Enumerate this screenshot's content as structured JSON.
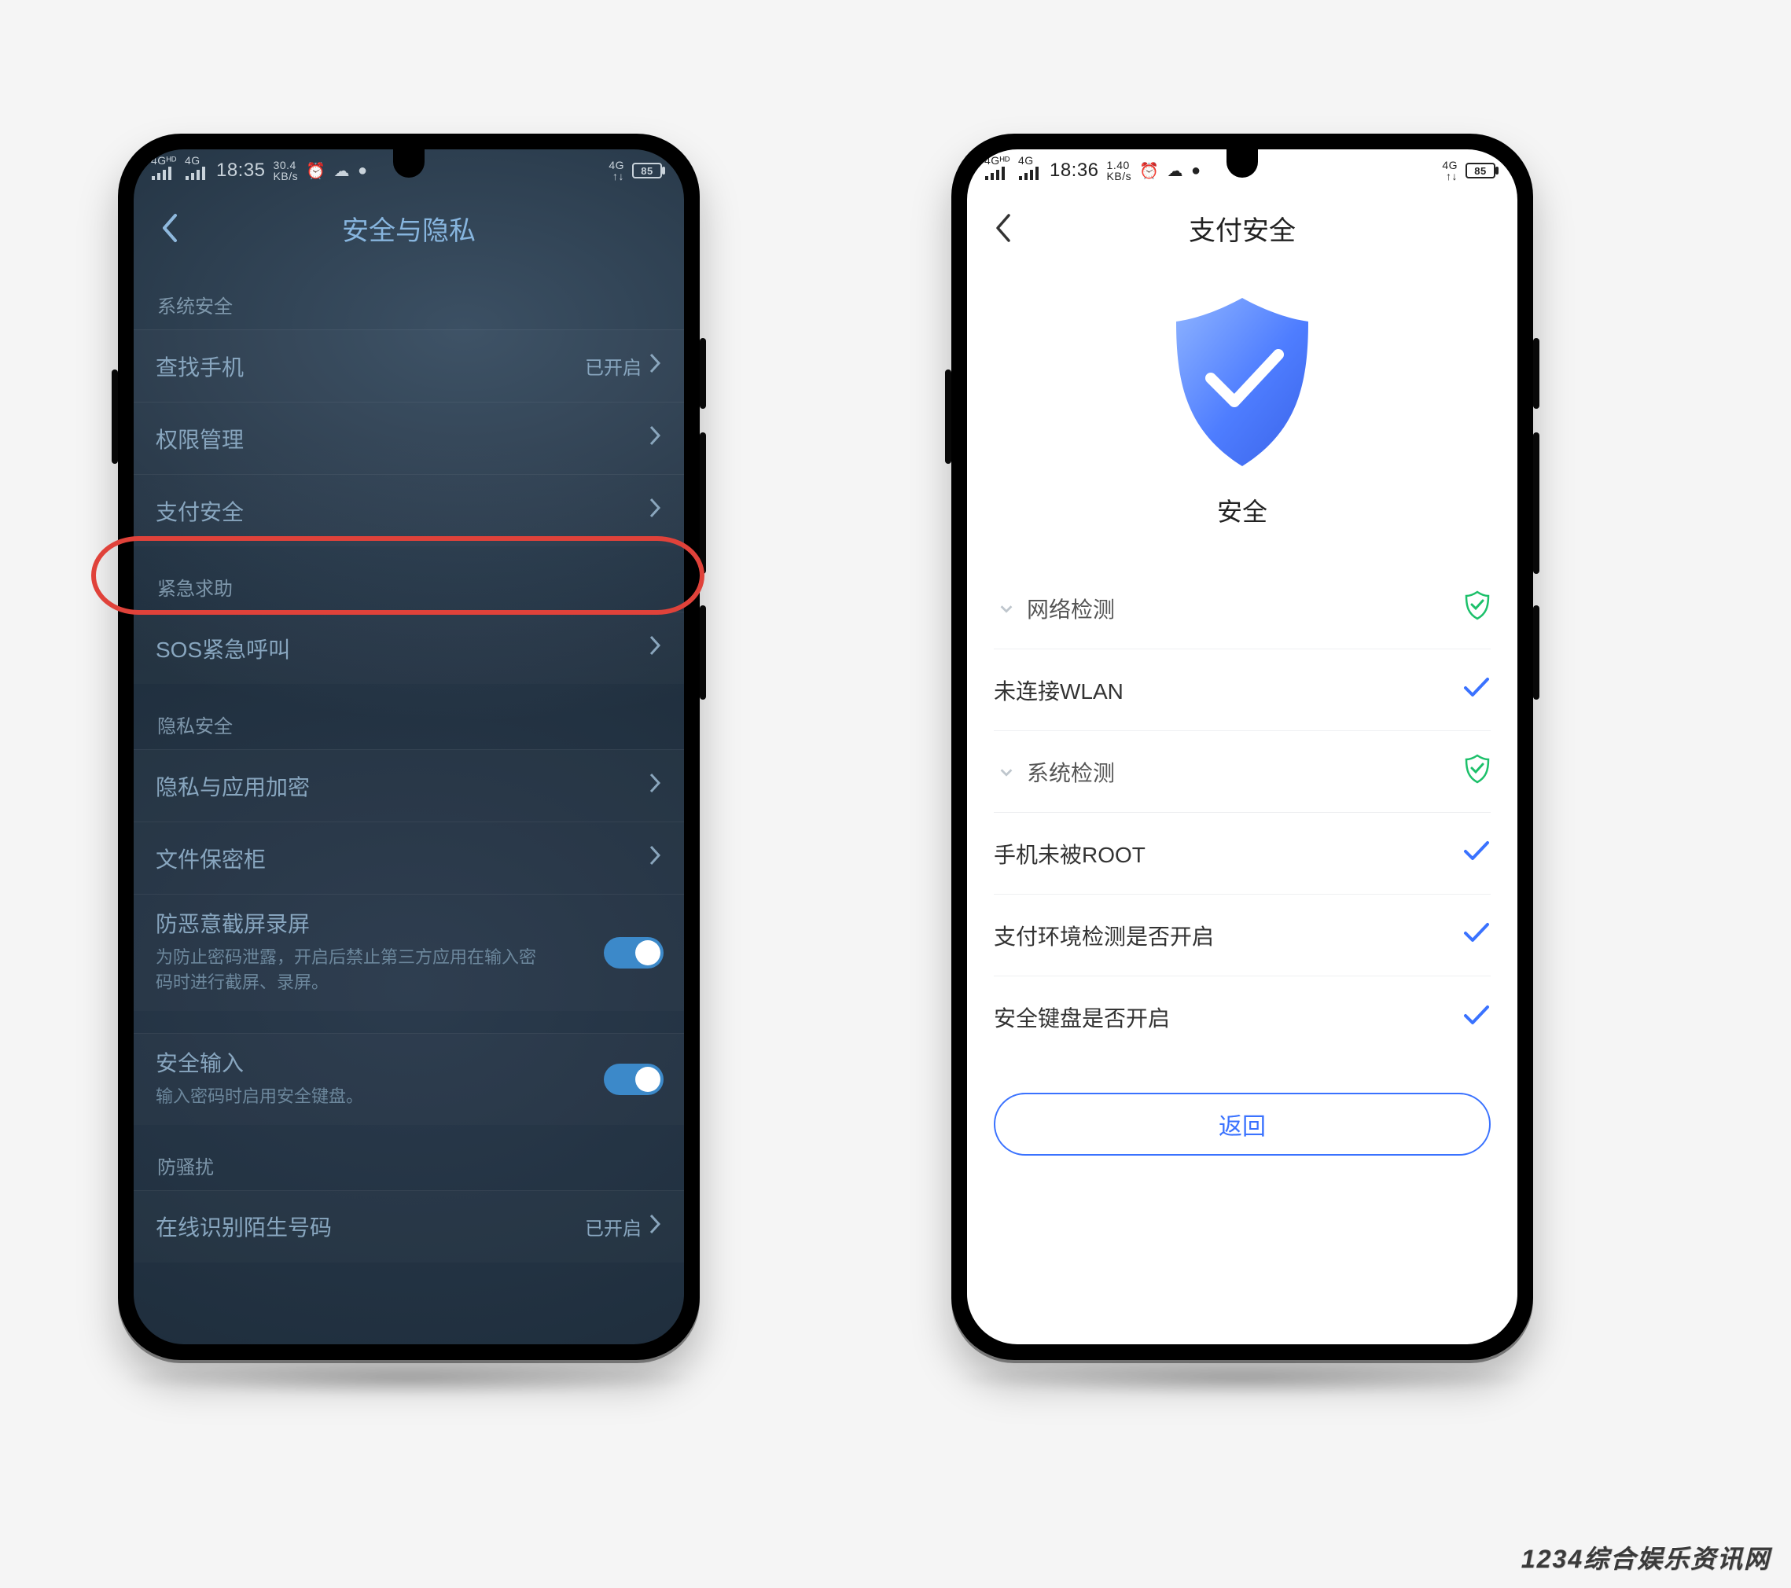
{
  "watermark": "1234综合娱乐资讯网",
  "phone1": {
    "status": {
      "net1": "4Gᴴᴰ",
      "net2": "4G",
      "time": "18:35",
      "speed_top": "30.4",
      "speed_unit": "KB/s",
      "battery": "85",
      "right_net": "4G"
    },
    "nav_title": "安全与隐私",
    "sections": {
      "sys": {
        "label": "系统安全",
        "items": [
          {
            "label": "查找手机",
            "value": "已开启"
          },
          {
            "label": "权限管理"
          },
          {
            "label": "支付安全"
          }
        ]
      },
      "sos": {
        "label": "紧急求助",
        "items": [
          {
            "label": "SOS紧急呼叫"
          }
        ]
      },
      "priv": {
        "label": "隐私安全",
        "items": [
          {
            "label": "隐私与应用加密"
          },
          {
            "label": "文件保密柜"
          }
        ],
        "blocks": [
          {
            "title": "防恶意截屏录屏",
            "sub": "为防止密码泄露，开启后禁止第三方应用在输入密码时进行截屏、录屏。"
          },
          {
            "title": "安全输入",
            "sub": "输入密码时启用安全键盘。"
          }
        ]
      },
      "spam": {
        "label": "防骚扰",
        "items": [
          {
            "label": "在线识别陌生号码",
            "value": "已开启"
          }
        ]
      }
    }
  },
  "phone2": {
    "status": {
      "net1": "4Gᴴᴰ",
      "net2": "4G",
      "time": "18:36",
      "speed_top": "1.40",
      "speed_unit": "KB/s",
      "battery": "85",
      "right_net": "4G"
    },
    "nav_title": "支付安全",
    "hero_label": "安全",
    "rows": {
      "net_head": "网络检测",
      "wlan": "未连接WLAN",
      "sys_head": "系统检测",
      "root": "手机未被ROOT",
      "env": "支付环境检测是否开启",
      "kb": "安全键盘是否开启"
    },
    "return_label": "返回"
  }
}
